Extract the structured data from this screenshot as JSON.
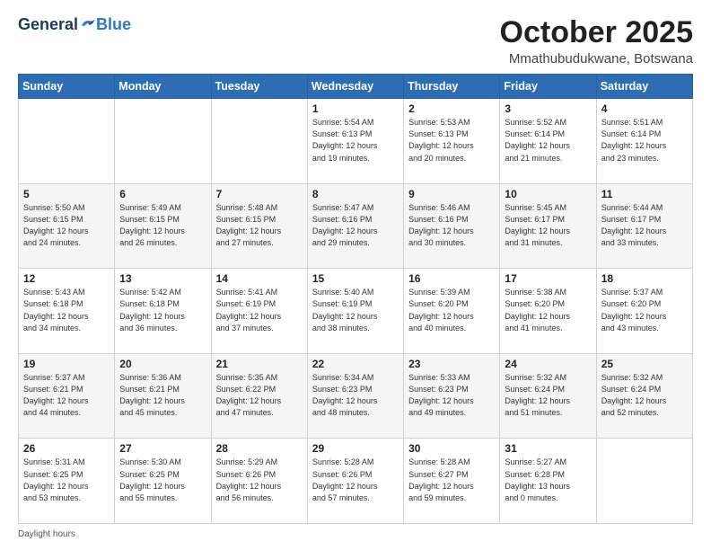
{
  "header": {
    "logo_general": "General",
    "logo_blue": "Blue",
    "month_title": "October 2025",
    "location": "Mmathubudukwane, Botswana"
  },
  "days_of_week": [
    "Sunday",
    "Monday",
    "Tuesday",
    "Wednesday",
    "Thursday",
    "Friday",
    "Saturday"
  ],
  "weeks": [
    [
      {
        "day": "",
        "info": ""
      },
      {
        "day": "",
        "info": ""
      },
      {
        "day": "",
        "info": ""
      },
      {
        "day": "1",
        "info": "Sunrise: 5:54 AM\nSunset: 6:13 PM\nDaylight: 12 hours\nand 19 minutes."
      },
      {
        "day": "2",
        "info": "Sunrise: 5:53 AM\nSunset: 6:13 PM\nDaylight: 12 hours\nand 20 minutes."
      },
      {
        "day": "3",
        "info": "Sunrise: 5:52 AM\nSunset: 6:14 PM\nDaylight: 12 hours\nand 21 minutes."
      },
      {
        "day": "4",
        "info": "Sunrise: 5:51 AM\nSunset: 6:14 PM\nDaylight: 12 hours\nand 23 minutes."
      }
    ],
    [
      {
        "day": "5",
        "info": "Sunrise: 5:50 AM\nSunset: 6:15 PM\nDaylight: 12 hours\nand 24 minutes."
      },
      {
        "day": "6",
        "info": "Sunrise: 5:49 AM\nSunset: 6:15 PM\nDaylight: 12 hours\nand 26 minutes."
      },
      {
        "day": "7",
        "info": "Sunrise: 5:48 AM\nSunset: 6:15 PM\nDaylight: 12 hours\nand 27 minutes."
      },
      {
        "day": "8",
        "info": "Sunrise: 5:47 AM\nSunset: 6:16 PM\nDaylight: 12 hours\nand 29 minutes."
      },
      {
        "day": "9",
        "info": "Sunrise: 5:46 AM\nSunset: 6:16 PM\nDaylight: 12 hours\nand 30 minutes."
      },
      {
        "day": "10",
        "info": "Sunrise: 5:45 AM\nSunset: 6:17 PM\nDaylight: 12 hours\nand 31 minutes."
      },
      {
        "day": "11",
        "info": "Sunrise: 5:44 AM\nSunset: 6:17 PM\nDaylight: 12 hours\nand 33 minutes."
      }
    ],
    [
      {
        "day": "12",
        "info": "Sunrise: 5:43 AM\nSunset: 6:18 PM\nDaylight: 12 hours\nand 34 minutes."
      },
      {
        "day": "13",
        "info": "Sunrise: 5:42 AM\nSunset: 6:18 PM\nDaylight: 12 hours\nand 36 minutes."
      },
      {
        "day": "14",
        "info": "Sunrise: 5:41 AM\nSunset: 6:19 PM\nDaylight: 12 hours\nand 37 minutes."
      },
      {
        "day": "15",
        "info": "Sunrise: 5:40 AM\nSunset: 6:19 PM\nDaylight: 12 hours\nand 38 minutes."
      },
      {
        "day": "16",
        "info": "Sunrise: 5:39 AM\nSunset: 6:20 PM\nDaylight: 12 hours\nand 40 minutes."
      },
      {
        "day": "17",
        "info": "Sunrise: 5:38 AM\nSunset: 6:20 PM\nDaylight: 12 hours\nand 41 minutes."
      },
      {
        "day": "18",
        "info": "Sunrise: 5:37 AM\nSunset: 6:20 PM\nDaylight: 12 hours\nand 43 minutes."
      }
    ],
    [
      {
        "day": "19",
        "info": "Sunrise: 5:37 AM\nSunset: 6:21 PM\nDaylight: 12 hours\nand 44 minutes."
      },
      {
        "day": "20",
        "info": "Sunrise: 5:36 AM\nSunset: 6:21 PM\nDaylight: 12 hours\nand 45 minutes."
      },
      {
        "day": "21",
        "info": "Sunrise: 5:35 AM\nSunset: 6:22 PM\nDaylight: 12 hours\nand 47 minutes."
      },
      {
        "day": "22",
        "info": "Sunrise: 5:34 AM\nSunset: 6:23 PM\nDaylight: 12 hours\nand 48 minutes."
      },
      {
        "day": "23",
        "info": "Sunrise: 5:33 AM\nSunset: 6:23 PM\nDaylight: 12 hours\nand 49 minutes."
      },
      {
        "day": "24",
        "info": "Sunrise: 5:32 AM\nSunset: 6:24 PM\nDaylight: 12 hours\nand 51 minutes."
      },
      {
        "day": "25",
        "info": "Sunrise: 5:32 AM\nSunset: 6:24 PM\nDaylight: 12 hours\nand 52 minutes."
      }
    ],
    [
      {
        "day": "26",
        "info": "Sunrise: 5:31 AM\nSunset: 6:25 PM\nDaylight: 12 hours\nand 53 minutes."
      },
      {
        "day": "27",
        "info": "Sunrise: 5:30 AM\nSunset: 6:25 PM\nDaylight: 12 hours\nand 55 minutes."
      },
      {
        "day": "28",
        "info": "Sunrise: 5:29 AM\nSunset: 6:26 PM\nDaylight: 12 hours\nand 56 minutes."
      },
      {
        "day": "29",
        "info": "Sunrise: 5:28 AM\nSunset: 6:26 PM\nDaylight: 12 hours\nand 57 minutes."
      },
      {
        "day": "30",
        "info": "Sunrise: 5:28 AM\nSunset: 6:27 PM\nDaylight: 12 hours\nand 59 minutes."
      },
      {
        "day": "31",
        "info": "Sunrise: 5:27 AM\nSunset: 6:28 PM\nDaylight: 13 hours\nand 0 minutes."
      },
      {
        "day": "",
        "info": ""
      }
    ]
  ],
  "footer": {
    "daylight_label": "Daylight hours"
  }
}
